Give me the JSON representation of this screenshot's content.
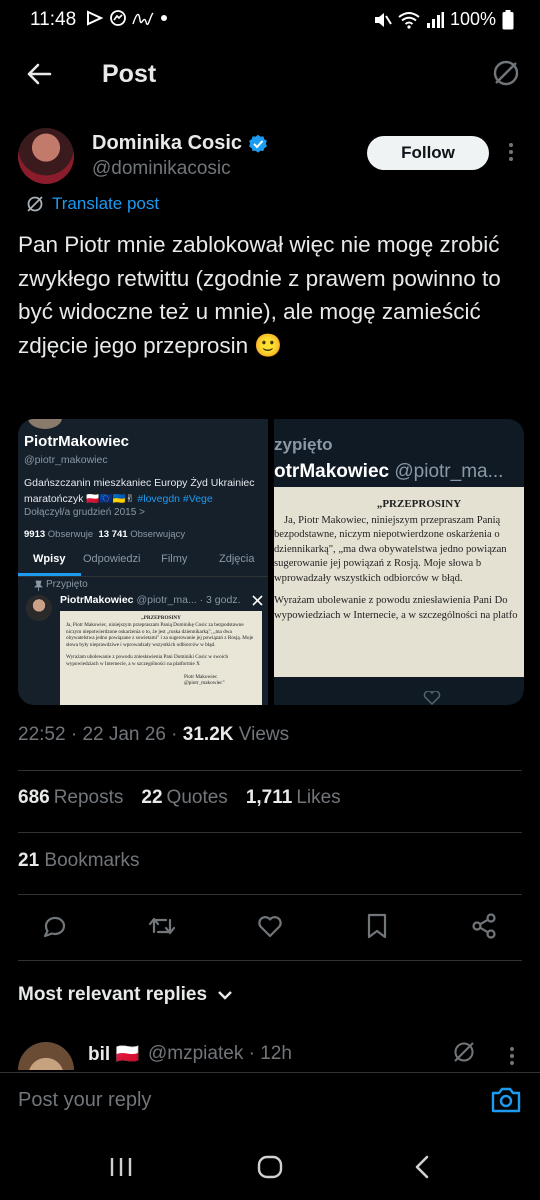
{
  "status_bar": {
    "time": "11:48",
    "battery": "100%"
  },
  "header": {
    "back_icon": "arrow-left-icon",
    "title": "Post",
    "translate_icon": "translate-icon"
  },
  "author": {
    "name": "Dominika Cosic",
    "handle": "@dominikacosic",
    "verified": true,
    "follow_label": "Follow"
  },
  "translate_label": "Translate post",
  "post_text": "Pan Piotr mnie zablokował więc nie mogę zrobić zwykłego retwittu (zgodnie z prawem powinno to być widoczne też u mnie), ale mogę zamieścić  zdjęcie jego przeprosin 🙂",
  "media": {
    "left": {
      "profile_name": "PiotrMakowiec",
      "profile_handle": "@piotr_makowiec",
      "bio_text": "Gdańszczanin mieszkaniec Europy Żyd Ukrainiec maratończyk 🇵🇱🇪🇺🇺🇦✌",
      "bio_tags": "#lovegdn #Vege",
      "joined": "Dołączył/a grudzień 2015 >",
      "following_count": "9913",
      "following_label": "Obserwuje",
      "followers_count": "13 741",
      "followers_label": "Obserwujący",
      "tabs": [
        "Wpisy",
        "Odpowiedzi",
        "Filmy",
        "Zdjęcia"
      ],
      "pinned": "Przypięto",
      "tweet_author": "PiotrMakowiec",
      "tweet_meta": "@piotr_ma... · 3 godz.",
      "doc_title": "„PRZEPROSINY",
      "doc_body": "Ja, Piotr Makowiec, niniejszym przepraszam Panią Dominikę Cosic za bezpodstawne niczym niepotwierdzone oskarżenia o to, że jest „ruska dziennikarką\", „ma dwa obywatelstwa jedno powiązane z sowietami\" i za sugerowanie jej powiązań z Rosją. Moje słowa były nieprawdziwe i wprowadzały wszystkich odbiorców w błąd.",
      "doc_body2": "Wyrażam ubolewanie z powodu zniesławienia Pani Dominiki Cosic w swoich wypowiedziach w Internecie, a w szczególności na platformie X",
      "doc_sign": "Piotr Makowiec",
      "doc_sign_handle": "@piotr_makowiec\""
    },
    "right": {
      "pinned": "zypięto",
      "tweet_author": "otrMakowiec",
      "tweet_handle": "@piotr_ma...",
      "doc_title": "„PRZEPROSINY",
      "doc_lines": [
        "Ja, Piotr Makowiec, niniejszym przepraszam Panią",
        "bezpodstawne, niczym niepotwierdzone oskarżenia o",
        "dziennikarką\", „ma dwa obywatelstwa jedno powiązan",
        "sugerowanie jej powiązań z Rosją. Moje słowa b",
        "wprowadzały wszystkich odbiorców w błąd.",
        "",
        "Wyrażam ubolewanie z powodu zniesławienia Pani Do",
        "wypowiedziach w Internecie, a w szczególności na platfo"
      ]
    }
  },
  "meta": {
    "time": "22:52",
    "date": "22 Jan 26",
    "views_count": "31.2K",
    "views_label": "Views"
  },
  "stats": {
    "reposts_count": "686",
    "reposts_label": "Reposts",
    "quotes_count": "22",
    "quotes_label": "Quotes",
    "likes_count": "1,711",
    "likes_label": "Likes",
    "bookmarks_count": "21",
    "bookmarks_label": "Bookmarks"
  },
  "actions": [
    "reply-icon",
    "repost-icon",
    "like-icon",
    "bookmark-icon",
    "share-icon"
  ],
  "replies_header": "Most relevant replies",
  "reply_preview": {
    "name": "bil 🇵🇱",
    "handle": "@mzpiatek · 12h"
  },
  "composer": {
    "placeholder": "Post your reply"
  },
  "colors": {
    "background": "#000000",
    "accent": "#1d9bf0",
    "text": "#e7e9ea",
    "muted": "#71767b"
  }
}
